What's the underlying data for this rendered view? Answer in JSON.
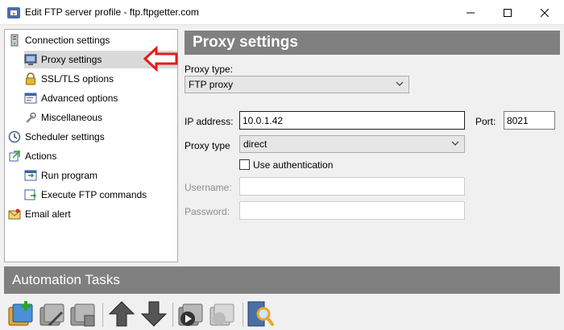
{
  "window": {
    "title": "Edit FTP server profile - ftp.ftpgetter.com"
  },
  "tree": {
    "items": [
      {
        "label": "Connection settings"
      },
      {
        "label": "Proxy settings"
      },
      {
        "label": "SSL/TLS options"
      },
      {
        "label": "Advanced options"
      },
      {
        "label": "Miscellaneous"
      },
      {
        "label": "Scheduler settings"
      },
      {
        "label": "Actions"
      },
      {
        "label": "Run program"
      },
      {
        "label": "Execute FTP commands"
      },
      {
        "label": "Email alert"
      }
    ],
    "selected": "Proxy settings"
  },
  "panel": {
    "title": "Proxy settings",
    "proxy_type_label": "Proxy type:",
    "proxy_type_value": "FTP proxy",
    "ip_label": "IP address:",
    "ip_value": "10.0.1.42",
    "port_label": "Port:",
    "port_value": "8021",
    "proxy_type2_label": "Proxy type",
    "proxy_type2_value": "direct",
    "use_auth_label": "Use authentication",
    "use_auth_checked": false,
    "username_label": "Username:",
    "username_value": "",
    "password_label": "Password:",
    "password_value": ""
  },
  "automation": {
    "title": "Automation Tasks",
    "toolbar_icons": [
      "add-task-icon",
      "edit-task-icon",
      "delete-task-icon",
      "move-up-icon",
      "move-down-icon",
      "run-task-icon",
      "stop-task-icon",
      "view-log-icon"
    ]
  },
  "colors": {
    "header_bg": "#808080",
    "header_text": "#ffffff",
    "selection_bg": "#d9d9d9",
    "arrow": "#e21c1c"
  }
}
